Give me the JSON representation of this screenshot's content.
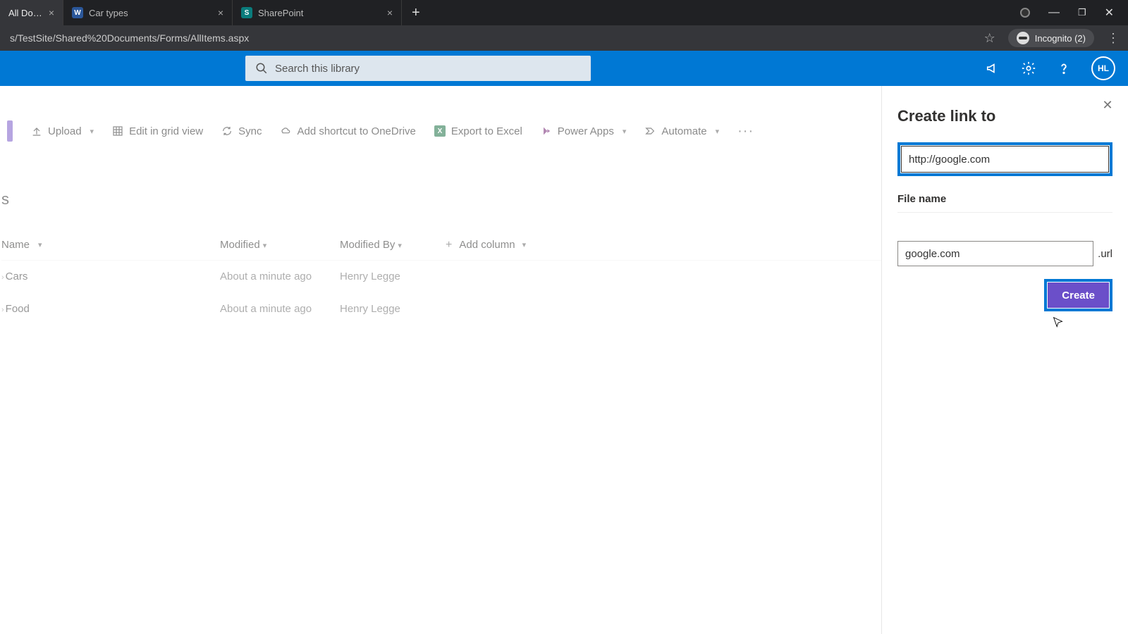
{
  "browser": {
    "tabs": [
      {
        "label": "All Docun",
        "icon_bg": "#4a7ab5",
        "icon_txt": "",
        "active": true
      },
      {
        "label": "Car types",
        "icon_bg": "#2b579a",
        "icon_txt": "W",
        "active": false
      },
      {
        "label": "SharePoint",
        "icon_bg": "#0a7c7c",
        "icon_txt": "S",
        "active": false
      }
    ],
    "address": "s/TestSite/Shared%20Documents/Forms/AllItems.aspx",
    "incognito_label": "Incognito (2)"
  },
  "suite": {
    "search_placeholder": "Search this library",
    "avatar_initials": "HL"
  },
  "commands": {
    "upload": "Upload",
    "edit_grid": "Edit in grid view",
    "sync": "Sync",
    "shortcut": "Add shortcut to OneDrive",
    "export": "Export to Excel",
    "powerapps": "Power Apps",
    "automate": "Automate"
  },
  "heading_fragment": "s",
  "columns": {
    "name": "Name",
    "modified": "Modified",
    "modified_by": "Modified By",
    "add": "Add column"
  },
  "rows": [
    {
      "name": "Cars",
      "modified": "About a minute ago",
      "by": "Henry Legge"
    },
    {
      "name": "Food",
      "modified": "About a minute ago",
      "by": "Henry Legge"
    }
  ],
  "panel": {
    "title": "Create link to",
    "url_value": "http://google.com",
    "filename_label": "File name",
    "filename_value": "google.com",
    "extension": ".url",
    "create_label": "Create"
  }
}
